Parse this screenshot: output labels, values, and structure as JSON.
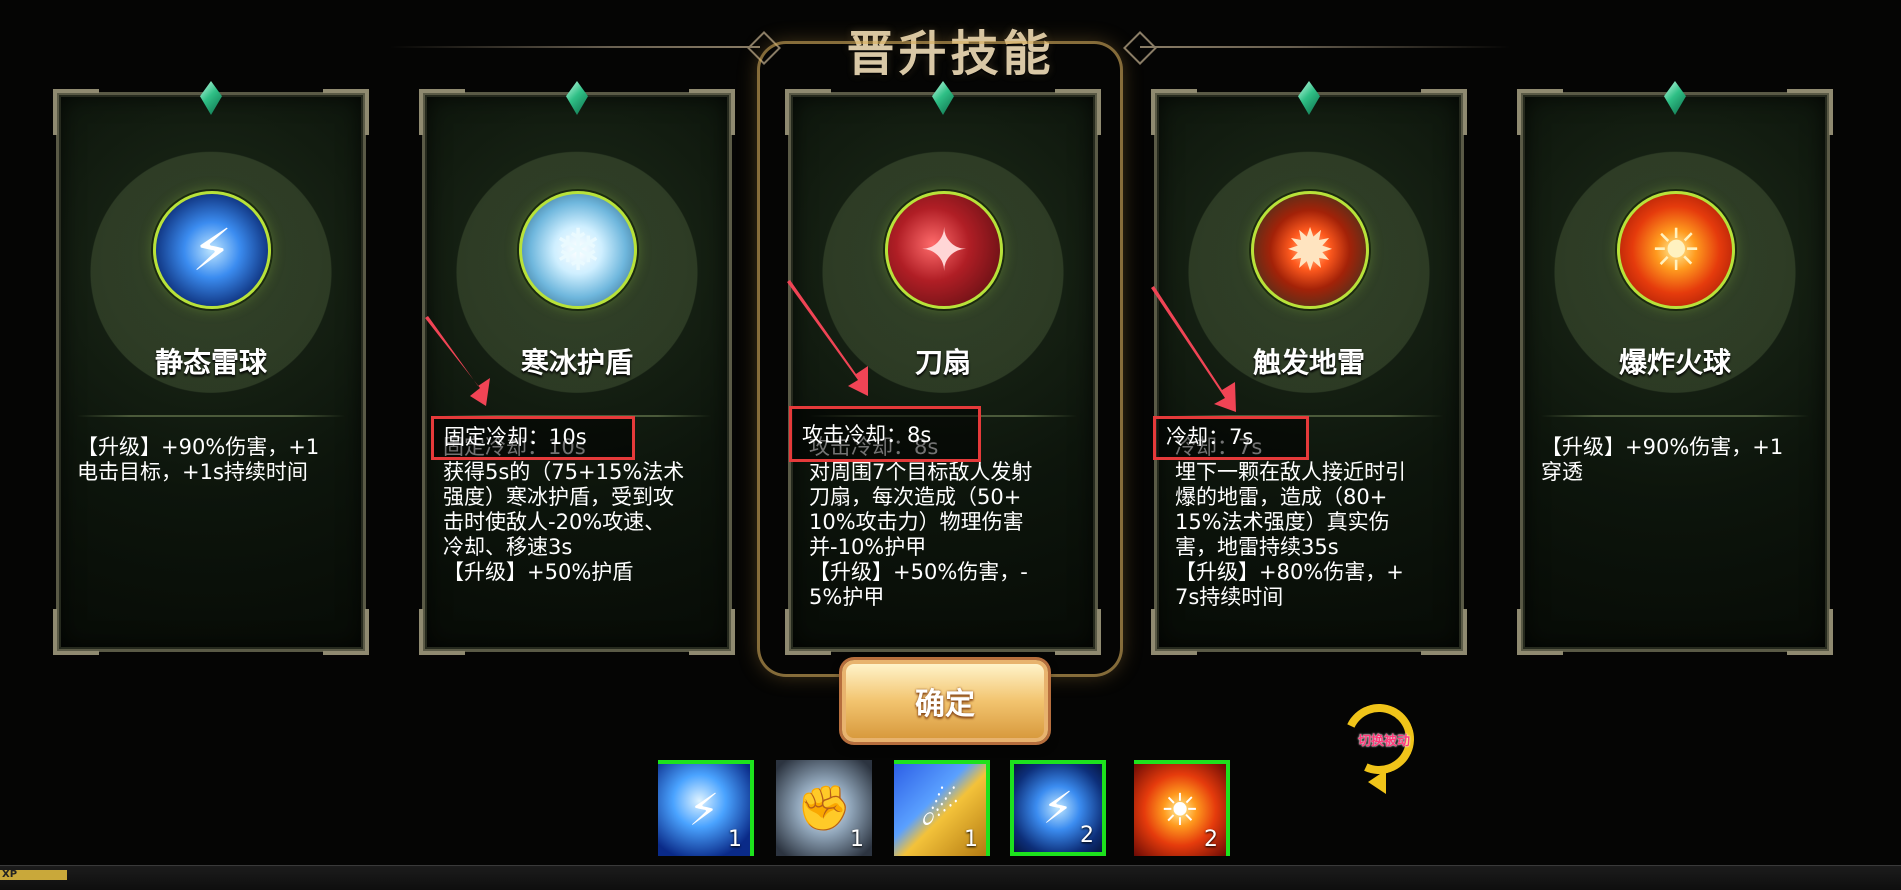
{
  "title": "晋升技能",
  "cards": [
    {
      "name": "静态雷球",
      "icon": "thunder-orb-icon",
      "desc": "【升级】+90%伤害，+1\n电击目标，+1s持续时间"
    },
    {
      "name": "寒冰护盾",
      "icon": "ice-shield-icon",
      "desc": "固定冷却：10s\n获得5s的（75+15%法术\n强度）寒冰护盾，受到攻\n击时使敌人-20%攻速、\n冷却、移速3s\n【升级】+50%护盾"
    },
    {
      "name": "刀扇",
      "icon": "blade-fan-icon",
      "desc": "攻击冷却：8s\n对周围7个目标敌人发射\n刀扇，每次造成（50+\n10%攻击力）物理伤害\n并-10%护甲\n【升级】+50%伤害，-\n5%护甲"
    },
    {
      "name": "触发地雷",
      "icon": "land-mine-icon",
      "desc": "冷却：7s\n埋下一颗在敌人接近时引\n爆的地雷，造成（80+\n15%法术强度）真实伤\n害，地雷持续35s\n【升级】+80%伤害，+\n7s持续时间"
    },
    {
      "name": "爆炸火球",
      "icon": "fireball-icon",
      "desc": "【升级】+90%伤害，+1\n穿透"
    }
  ],
  "annotations": [
    "固定冷却：10s",
    "攻击冷却：8s",
    "冷却：7s"
  ],
  "confirm_label": "确定",
  "toggle_label": "切换被动",
  "skill_slots": [
    {
      "icon": "lightning-strike-icon",
      "level": "1"
    },
    {
      "icon": "ice-fist-icon",
      "level": "1"
    },
    {
      "icon": "comet-icon",
      "level": "1"
    },
    {
      "icon": "thunder-orb-icon",
      "level": "2"
    },
    {
      "icon": "fireball-icon",
      "level": "2"
    }
  ],
  "exp_label": "XP",
  "exp_progress": 0.035,
  "colors": {
    "accent_gold": "#d9c8a6",
    "annotation_red": "#e53a3a",
    "slot_green": "#1de21d",
    "icon_ring": "#b8e23a"
  }
}
